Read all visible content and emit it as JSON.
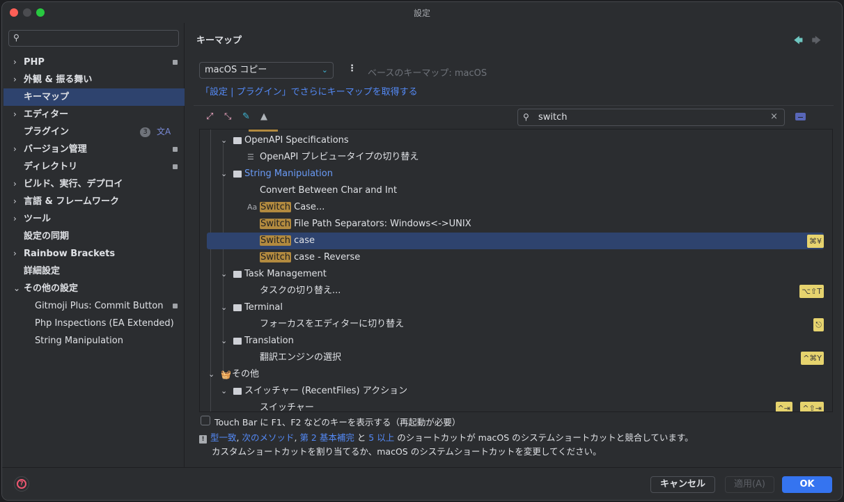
{
  "window": {
    "title": "設定"
  },
  "sidebar": {
    "search_placeholder": "",
    "items": [
      {
        "label": "PHP",
        "expandable": true,
        "project_badge": true
      },
      {
        "label": "外観 & 振る舞い",
        "expandable": true
      },
      {
        "label": "キーマップ",
        "selected": true
      },
      {
        "label": "エディター",
        "expandable": true
      },
      {
        "label": "プラグイン",
        "count": "3",
        "translate_icon": "文A"
      },
      {
        "label": "バージョン管理",
        "expandable": true,
        "project_badge": true
      },
      {
        "label": "ディレクトリ",
        "project_badge": true
      },
      {
        "label": "ビルド、実行、デプロイ",
        "expandable": true
      },
      {
        "label": "言語 & フレームワーク",
        "expandable": true
      },
      {
        "label": "ツール",
        "expandable": true
      },
      {
        "label": "設定の同期"
      },
      {
        "label": "Rainbow Brackets",
        "expandable": true
      },
      {
        "label": "詳細設定"
      },
      {
        "label": "その他の設定",
        "expanded": true
      },
      {
        "label": "Gitmoji Plus: Commit Button",
        "child": true,
        "project_badge": true
      },
      {
        "label": "Php Inspections (EA Extended)",
        "child": true
      },
      {
        "label": "String Manipulation",
        "child": true
      }
    ]
  },
  "main": {
    "title": "キーマップ",
    "keymap_select": "macOS コピー",
    "base_keymap": "ベースのキーマップ: macOS",
    "plugin_link": "「設定 | プラグイン」でさらにキーマップを取得する",
    "filter_value": "switch",
    "tree": [
      {
        "type": "group",
        "label": "OpenAPI Specifications",
        "level": 1
      },
      {
        "type": "action",
        "label": "OpenAPI プレビュータイプの切り替え",
        "icon": "list-icon"
      },
      {
        "type": "group",
        "label": "String Manipulation",
        "level": 1,
        "link": true
      },
      {
        "type": "action",
        "label": "Convert Between Char and Int"
      },
      {
        "type": "action",
        "hl": "Switch",
        "label": " Case...",
        "icon": "text-case-icon"
      },
      {
        "type": "action",
        "hl": "Switch",
        "label": " File Path Separators: Windows<->UNIX"
      },
      {
        "type": "action",
        "hl": "Switch",
        "label": " case",
        "selected": true,
        "shortcuts": [
          "⌘¥"
        ]
      },
      {
        "type": "action",
        "hl": "Switch",
        "label": " case - Reverse"
      },
      {
        "type": "group",
        "label": "Task Management",
        "level": 1
      },
      {
        "type": "action",
        "label": "タスクの切り替え...",
        "shortcuts": [
          "⌥⇧T"
        ]
      },
      {
        "type": "group",
        "label": "Terminal",
        "level": 1
      },
      {
        "type": "action",
        "label": "フォーカスをエディターに切り替え",
        "shortcuts": [
          "⎋"
        ]
      },
      {
        "type": "group",
        "label": "Translation",
        "level": 1
      },
      {
        "type": "action",
        "label": "翻訳エンジンの選択",
        "shortcuts": [
          "^⌘Y"
        ]
      },
      {
        "type": "group",
        "label": "その他",
        "level": 0,
        "basket": true
      },
      {
        "type": "group",
        "label": "スイッチャー (RecentFiles) アクション",
        "level": 1
      },
      {
        "type": "action",
        "label": "スイッチャー",
        "shortcuts": [
          "^⇥",
          "^⇧⇥"
        ]
      }
    ],
    "touchbar_label": "Touch Bar に F1、F2 などのキーを表示する（再起動が必要）",
    "touchbar_checked": false,
    "conflict": {
      "links": [
        "型一致",
        "次のメソッド",
        "第 2 基本補完",
        "5 以上"
      ],
      "sep1": ", ",
      "sep2": ", ",
      "and": " と ",
      "text1": " のショートカットが macOS のシステムショートカットと競合しています。",
      "text2": "カスタムショートカットを割り当てるか、macOS のシステムショートカットを変更してください。"
    }
  },
  "footer": {
    "cancel": "キャンセル",
    "apply": "適用(A)",
    "ok": "OK"
  },
  "colors": {
    "accent": "#3574f0",
    "selection": "#2e436e",
    "highlight": "#b28a3f",
    "shortcut_bg": "#e6d36e",
    "link": "#548af7"
  }
}
